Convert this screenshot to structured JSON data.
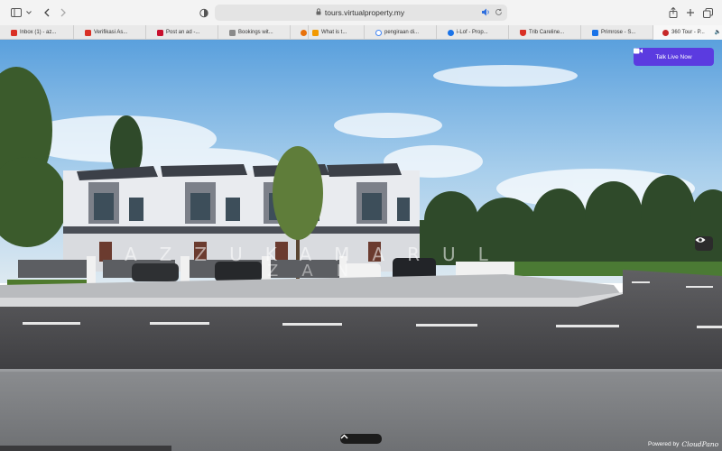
{
  "browser": {
    "url": "tours.virtualproperty.my",
    "tabs": [
      {
        "label": "Inbox (1) - az...",
        "favicon_color": "#d93025",
        "icon": "gmail-icon"
      },
      {
        "label": "Verifikasi As...",
        "favicon_color": "#d93025",
        "icon": "gmail-icon"
      },
      {
        "label": "Post an ad -...",
        "favicon_color": "#c8102e",
        "icon": "mudah-icon"
      },
      {
        "label": "Bookings wit...",
        "favicon_color": "#8a8a8a",
        "icon": "bookings-icon"
      },
      {
        "label": "",
        "favicon_color": "#e8710a",
        "icon": "site-icon"
      },
      {
        "label": "What is t...",
        "favicon_color": "#f29900",
        "icon": "bookmark-icon"
      },
      {
        "label": "pengiraan di...",
        "favicon_color": "#4285f4",
        "icon": "google-icon"
      },
      {
        "label": "i-Lof - Prop...",
        "favicon_color": "#1a73e8",
        "icon": "globe-icon"
      },
      {
        "label": "Trib Careline...",
        "favicon_color": "#d93025",
        "icon": "shield-icon"
      },
      {
        "label": "Primrose - S...",
        "favicon_color": "#1a73e8",
        "icon": "primrose-icon"
      },
      {
        "label": "360 Tour - P...",
        "favicon_color": "#c62828",
        "icon": "tour-icon",
        "active": true
      }
    ]
  },
  "tour": {
    "watermark_line1": "AZZUKAMARUL",
    "watermark_line2": "ZAN",
    "talk_button_label": "Talk Live Now",
    "powered_label": "Powered by",
    "powered_brand": "CloudPano"
  },
  "colors": {
    "accent": "#5b3be0",
    "sky_top": "#5aa0dd",
    "road": "#4a4a4c"
  }
}
